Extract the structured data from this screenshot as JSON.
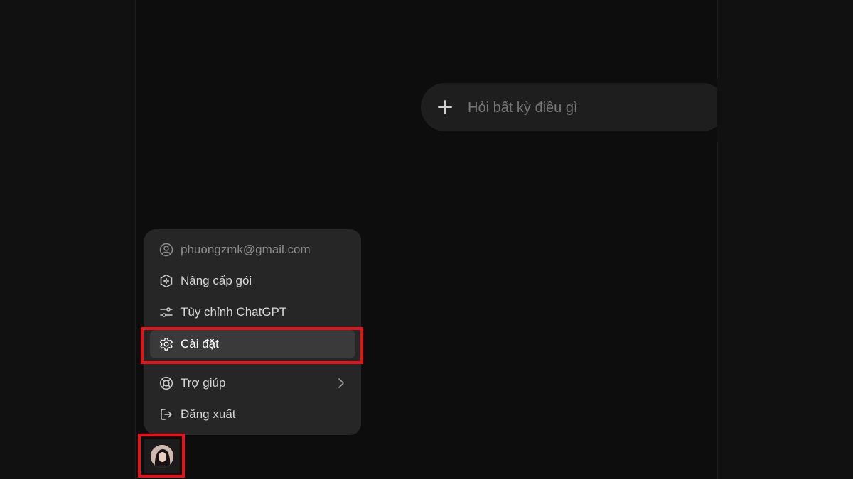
{
  "composer": {
    "placeholder": "Hỏi bất kỳ điều gì",
    "plus_icon": "plus-icon"
  },
  "account_menu": {
    "items": [
      {
        "label": "phuongzmk@gmail.com",
        "icon": "user-circle-icon"
      },
      {
        "label": "Nâng cấp gói",
        "icon": "upgrade-sparkle-icon"
      },
      {
        "label": "Tùy chỉnh ChatGPT",
        "icon": "sliders-icon"
      },
      {
        "label": "Cài đặt",
        "icon": "gear-icon",
        "highlighted": true
      },
      {
        "label": "Trợ giúp",
        "icon": "lifebuoy-icon",
        "has_submenu": true
      },
      {
        "label": "Đăng xuất",
        "icon": "logout-icon"
      }
    ]
  },
  "avatar": {
    "icon": "profile-photo"
  },
  "colors": {
    "background": "#0d0d0d",
    "menu_background": "#262626",
    "active_item": "#3a3a3a",
    "highlight_box": "#e4131a",
    "composer_background": "#1e1e1e"
  }
}
